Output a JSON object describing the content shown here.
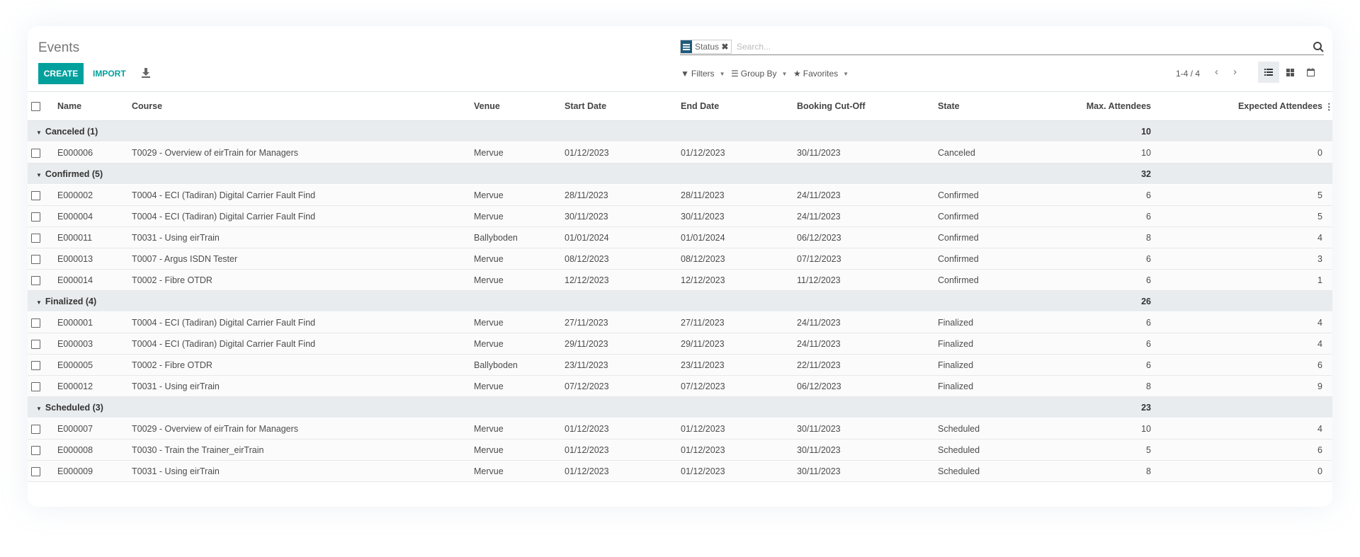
{
  "title": "Events",
  "toolbar": {
    "create_label": "CREATE",
    "import_label": "IMPORT",
    "download_icon": "download-icon"
  },
  "search": {
    "facet_label": "Status",
    "placeholder": "Search..."
  },
  "filters": {
    "filters_label": "Filters",
    "groupby_label": "Group By",
    "favorites_label": "Favorites"
  },
  "pager": {
    "text": "1-4 / 4"
  },
  "views": [
    "list",
    "kanban",
    "calendar"
  ],
  "colors": {
    "accent": "#00a09d",
    "facet": "#1e5b7e",
    "group_bg": "#e9ecef"
  },
  "columns": [
    "Name",
    "Course",
    "Venue",
    "Start Date",
    "End Date",
    "Booking Cut-Off",
    "State",
    "Max. Attendees",
    "Expected Attendees"
  ],
  "groups": [
    {
      "label": "Canceled (1)",
      "max_total": "10",
      "rows": [
        [
          "E000006",
          "T0029 - Overview of eirTrain for Managers",
          "Mervue",
          "01/12/2023",
          "01/12/2023",
          "30/11/2023",
          "Canceled",
          "10",
          "0"
        ]
      ]
    },
    {
      "label": "Confirmed (5)",
      "max_total": "32",
      "rows": [
        [
          "E000002",
          "T0004 - ECI (Tadiran) Digital Carrier Fault Find",
          "Mervue",
          "28/11/2023",
          "28/11/2023",
          "24/11/2023",
          "Confirmed",
          "6",
          "5"
        ],
        [
          "E000004",
          "T0004 - ECI (Tadiran) Digital Carrier Fault Find",
          "Mervue",
          "30/11/2023",
          "30/11/2023",
          "24/11/2023",
          "Confirmed",
          "6",
          "5"
        ],
        [
          "E000011",
          "T0031 - Using eirTrain",
          "Ballyboden",
          "01/01/2024",
          "01/01/2024",
          "06/12/2023",
          "Confirmed",
          "8",
          "4"
        ],
        [
          "E000013",
          "T0007 - Argus ISDN Tester",
          "Mervue",
          "08/12/2023",
          "08/12/2023",
          "07/12/2023",
          "Confirmed",
          "6",
          "3"
        ],
        [
          "E000014",
          "T0002 - Fibre OTDR",
          "Mervue",
          "12/12/2023",
          "12/12/2023",
          "11/12/2023",
          "Confirmed",
          "6",
          "1"
        ]
      ]
    },
    {
      "label": "Finalized (4)",
      "max_total": "26",
      "rows": [
        [
          "E000001",
          "T0004 - ECI (Tadiran) Digital Carrier Fault Find",
          "Mervue",
          "27/11/2023",
          "27/11/2023",
          "24/11/2023",
          "Finalized",
          "6",
          "4"
        ],
        [
          "E000003",
          "T0004 - ECI (Tadiran) Digital Carrier Fault Find",
          "Mervue",
          "29/11/2023",
          "29/11/2023",
          "24/11/2023",
          "Finalized",
          "6",
          "4"
        ],
        [
          "E000005",
          "T0002 - Fibre OTDR",
          "Ballyboden",
          "23/11/2023",
          "23/11/2023",
          "22/11/2023",
          "Finalized",
          "6",
          "6"
        ],
        [
          "E000012",
          "T0031 - Using eirTrain",
          "Mervue",
          "07/12/2023",
          "07/12/2023",
          "06/12/2023",
          "Finalized",
          "8",
          "9"
        ]
      ]
    },
    {
      "label": "Scheduled (3)",
      "max_total": "23",
      "rows": [
        [
          "E000007",
          "T0029 - Overview of eirTrain for Managers",
          "Mervue",
          "01/12/2023",
          "01/12/2023",
          "30/11/2023",
          "Scheduled",
          "10",
          "4"
        ],
        [
          "E000008",
          "T0030 - Train the Trainer_eirTrain",
          "Mervue",
          "01/12/2023",
          "01/12/2023",
          "30/11/2023",
          "Scheduled",
          "5",
          "6"
        ],
        [
          "E000009",
          "T0031 - Using eirTrain",
          "Mervue",
          "01/12/2023",
          "01/12/2023",
          "30/11/2023",
          "Scheduled",
          "8",
          "0"
        ]
      ]
    }
  ]
}
